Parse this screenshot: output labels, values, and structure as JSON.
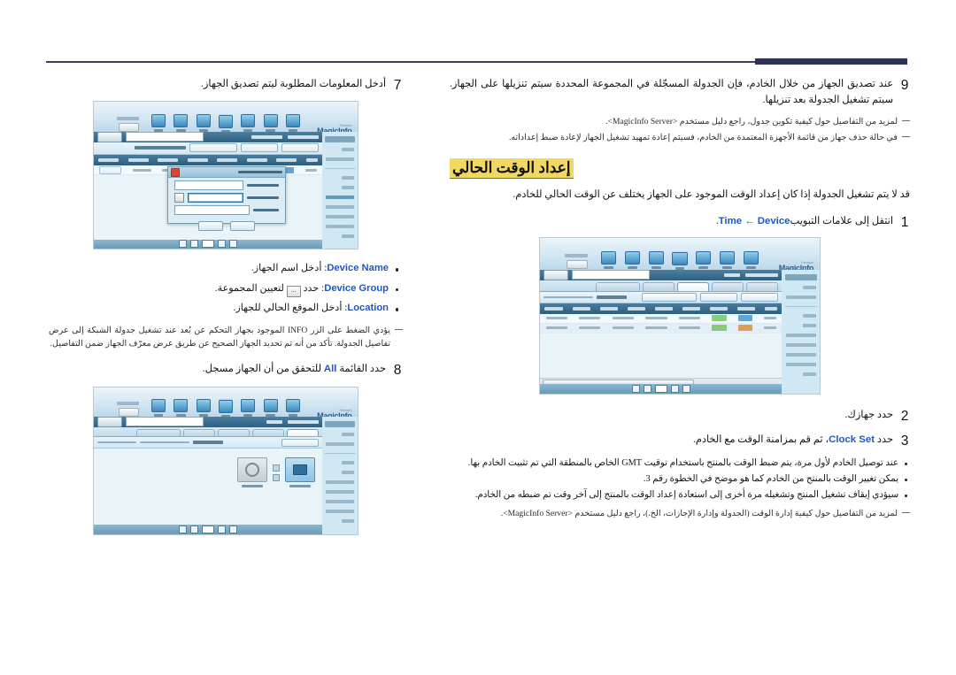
{
  "page": {
    "direction": "rtl",
    "language": "Arabic",
    "accent_navy": "#2e3356",
    "accent_blue": "#1f57c6",
    "highlight_yellow": "#f2d760"
  },
  "left_column": {
    "steps": [
      {
        "number": "9",
        "text": "عند تصديق الجهاز من خلال الخادم، فإن الجدولة المسجّلة في المجموعة المحددة سيتم تنزيلها على الجهاز. سيتم تشغيل الجدولة بعد تنزيلها."
      }
    ],
    "notes": [
      "لمزيد من التفاصيل حول كيفية تكوين جدول، راجع دليل مستخدم <MagicInfo Server>.",
      "في حالة حذف جهاز من قائمة الأجهزة المعتمدة من الخادم، فسيتم إعادة تمهيد تشغيل الجهاز لإعادة ضبط إعداداته."
    ],
    "section_heading": "إعداد الوقت الحالي",
    "intro": "قد لا يتم تشغيل الجدولة إذا كان إعداد الوقت الموجود على الجهاز يختلف عن الوقت الحالي للخادم.",
    "steps2": [
      {
        "number": "1",
        "text_before": "انتقل إلى علامات التبويب",
        "en": "Time ← Device",
        "text_after": "."
      },
      {
        "number": "2",
        "text": "حدد جهازك."
      },
      {
        "number": "3",
        "text_before": "حدد",
        "en": "Clock Set",
        "text_after": "، ثم قم بمزامنة الوقت مع الخادم."
      }
    ],
    "bullets": [
      "عند توصيل الخادم لأول مرة، يتم ضبط الوقت بالمنتج باستخدام توقيت GMT الخاص بالمنطقة التي تم تثبيت الخادم بها.",
      "يمكن تغيير الوقت بالمنتج من الخادم كما هو موضح في الخطوة رقم 3.",
      "سيؤدي إيقاف تشغيل المنتج وتشغيله مرة أخرى إلى استعادة إعداد الوقت بالمنتج إلى آخر وقت تم ضبطه من الخادم."
    ],
    "final_note": "لمزيد من التفاصيل حول كيفية إدارة الوقت (الجدولة وإدارة الإجازات، الخ.)، راجع دليل مستخدم <MagicInfo Server>."
  },
  "right_column": {
    "steps": [
      {
        "number": "7",
        "text": "أدخل المعلومات المطلوبة ليتم تصديق الجهاز."
      },
      {
        "number": "8",
        "text_before": "حدد القائمة",
        "en": "All",
        "text_after": "للتحقق من أن الجهاز مسجل."
      }
    ],
    "fields": [
      {
        "key": "Device Name",
        "desc": "أدخل اسم الجهاز.",
        "has_browse": false
      },
      {
        "key": "Device Group",
        "desc_before": "حدد",
        "desc_after": "لتعيين المجموعة.",
        "has_browse": true,
        "browse_label": "..."
      },
      {
        "key": "Location",
        "desc": "أدخل الموقع الحالي للجهاز.",
        "has_browse": false
      }
    ],
    "note": "يؤدي الضغط على الزر INFO الموجود بجهاز التحكم عن بُعد عند تشغيل جدولة الشبكة إلى عرض تفاصيل الجدولة. تأكد من أنه تم تحديد الجهاز الصحيح عن طريق عرض معرّف الجهاز ضمن التفاصيل."
  },
  "screenshots": {
    "device_approve": {
      "name": "MagicInfo Premium device approval screen",
      "logo": "MagicInfo",
      "logo_sub": "Premium",
      "nav_tabs": [
        "Content",
        "Playlist",
        "Schedule",
        "Device",
        "User",
        "Statistics",
        "Setting"
      ],
      "nav_selected": "Device",
      "sidebar_title": "Premium",
      "sidebar_items": [
        "All",
        "by Group",
        "Total",
        "Alarm",
        "Unapproved",
        "Disconnect",
        "Error Display",
        "Sample List",
        "Log"
      ],
      "breadcrumb": [
        "Device",
        "Unapproved"
      ],
      "toolbar_buttons": [
        "Approve",
        "Delete",
        "Reject Device"
      ],
      "table_title": "Device Search",
      "table_headers": [
        "",
        "Device Type",
        "Device Name",
        "IP",
        "Registered",
        "Device Group",
        "Device Model Name",
        "Approve"
      ],
      "table_rows": [
        [
          "",
          "UD-555",
          "SERIAL00001",
          "192.168.0.10",
          "2012-10-11 10:20",
          "Group1",
          "UD55C",
          "Approve"
        ]
      ],
      "search_button": "Search",
      "logout_button": "Logout",
      "modal": {
        "title": "Device Approval",
        "fields": [
          {
            "label": "Device Name",
            "value": "UD55C"
          },
          {
            "label": "Device Group",
            "value": "Group1"
          },
          {
            "label": "Location",
            "value": ""
          }
        ],
        "buttons": [
          "OK",
          "Cancel"
        ]
      }
    },
    "device_time": {
      "name": "MagicInfo Premium Device Time tab screen",
      "logo": "MagicInfo",
      "logo_sub": "Premium",
      "nav_tabs": [
        "Content",
        "Playlist",
        "Schedule",
        "Device",
        "User",
        "Statistics",
        "Setting"
      ],
      "nav_selected": "Device",
      "sidebar_title": "Premium",
      "sidebar_items": [
        "All",
        "by Group",
        "Total",
        "Alarm",
        "Unapproved",
        "Disconnect",
        "Error Display",
        "Sample List",
        "Log"
      ],
      "breadcrumb": [
        "Device",
        "All"
      ],
      "tabs": [
        "Monitoring",
        "Information",
        "Time",
        "Setup",
        "Display Control"
      ],
      "tab_selected": "Time",
      "toolbar_buttons": [
        "Clock Set",
        "Timer Set",
        "Holiday Management"
      ],
      "select_label": "Select Group",
      "select_value": "All",
      "table_headers": [
        "",
        "Device Type",
        "Device Name",
        "Clock Set",
        "Timer1",
        "Timer2",
        "Timer3",
        "Timer4",
        "Timer5"
      ],
      "table_rows": [
        [
          "",
          "UD-555",
          "Monitor",
          "",
          "",
          "",
          "",
          "",
          ""
        ],
        [
          "",
          "UD-555",
          "Monitor-2",
          "",
          "",
          "",
          "",
          "",
          ""
        ]
      ],
      "pagination": "1"
    },
    "device_all": {
      "name": "MagicInfo Premium Device All monitoring screen",
      "logo": "MagicInfo",
      "logo_sub": "Premium",
      "nav_tabs": [
        "Content",
        "Playlist",
        "Schedule",
        "Device",
        "User",
        "Statistics",
        "Setting"
      ],
      "nav_selected": "Device",
      "sidebar_title": "Premium",
      "sidebar_items": [
        "All",
        "by Group",
        "Total",
        "Alarm",
        "Unapproved",
        "Disconnect",
        "Error Display",
        "Sample List",
        "Log"
      ],
      "breadcrumb": [
        "Device",
        "All"
      ],
      "tabs": [
        "Monitoring",
        "Information",
        "Time",
        "Setup",
        "Display Control"
      ],
      "tab_selected": "Monitoring",
      "toolbar_buttons": [
        "Delete"
      ],
      "select_label": "Select Device",
      "select_value": "Thumbnail",
      "select_value2": "All",
      "tiles": [
        {
          "label": "Monitor",
          "state": "on"
        },
        {
          "label": "Monitor-2",
          "state": "off"
        }
      ]
    }
  }
}
